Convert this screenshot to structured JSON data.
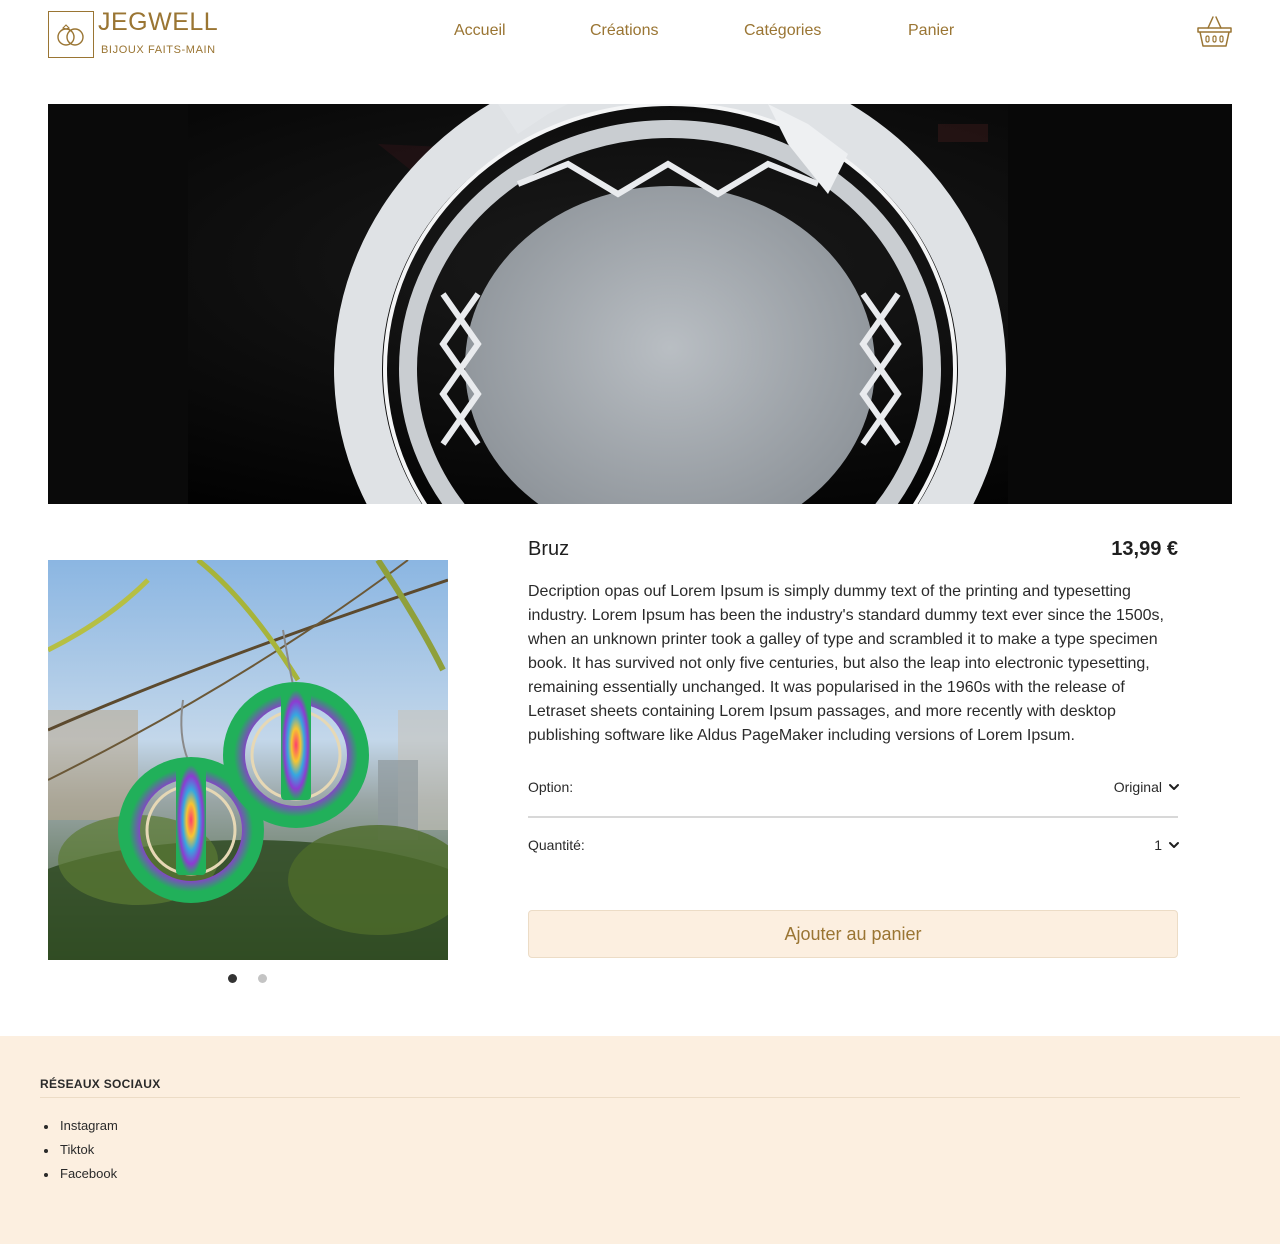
{
  "brand": {
    "name": "JEGWELL",
    "tagline": "BIJOUX FAITS-MAIN",
    "logo_icon": "rings-icon"
  },
  "nav": {
    "items": [
      "Accueil",
      "Créations",
      "Catégories",
      "Panier"
    ],
    "cart_icon": "basket-icon"
  },
  "product": {
    "name": "Bruz",
    "price": "13,99 €",
    "description": "Decription opas ouf Lorem Ipsum is simply dummy text of the printing and typesetting industry. Lorem Ipsum has been the industry's standard dummy text ever since the 1500s, when an unknown printer took a galley of type and scrambled it to make a type specimen book. It has survived not only five centuries, but also the leap into electronic typesetting, remaining essentially unchanged. It was popularised in the 1960s with the release of Letraset sheets containing Lorem Ipsum passages, and more recently with desktop publishing software like Aldus PageMaker including versions of Lorem Ipsum.",
    "option_label": "Option:",
    "option_value": "Original",
    "quantity_label": "Quantité:",
    "quantity_value": "1",
    "add_to_cart": "Ajouter au panier",
    "carousel_slides": 2,
    "carousel_active": 1
  },
  "footer": {
    "title": "RÉSEAUX SOCIAUX",
    "links": [
      "Instagram",
      "Tiktok",
      "Facebook"
    ]
  },
  "colors": {
    "accent": "#9a7533",
    "cream": "#fcefe0",
    "text": "#1f1f1f"
  }
}
